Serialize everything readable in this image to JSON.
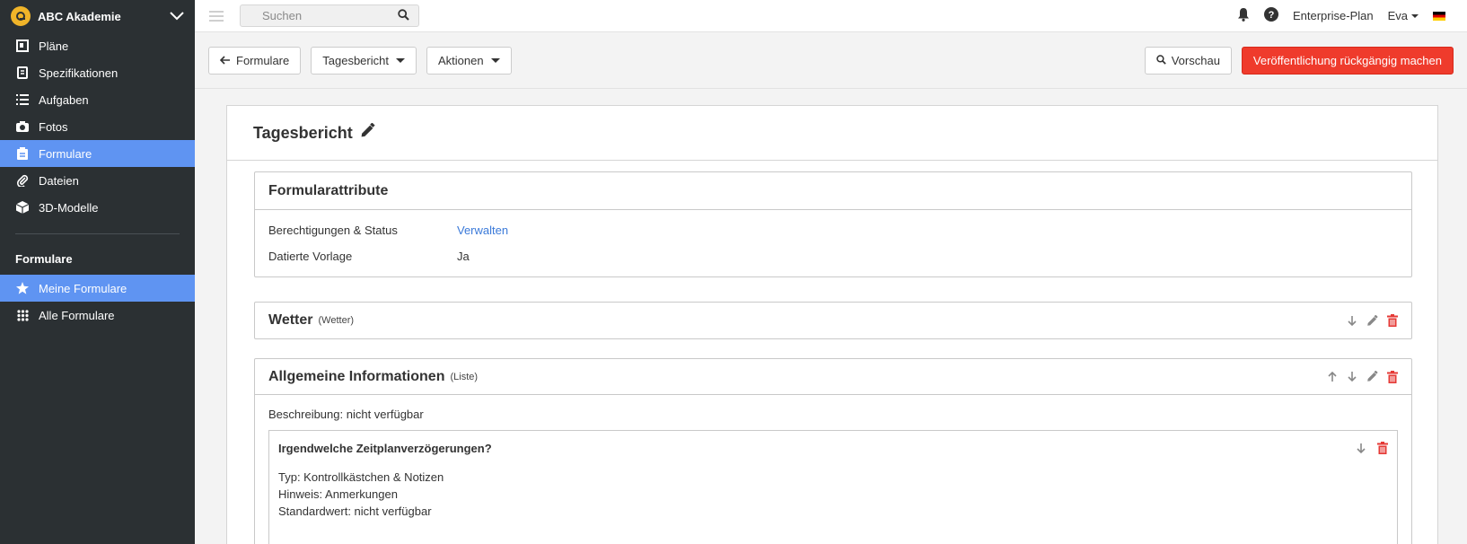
{
  "sidebar": {
    "org_name": "ABC Akademie",
    "items": [
      {
        "label": "Pläne",
        "icon": "plans-icon"
      },
      {
        "label": "Spezifikationen",
        "icon": "specs-icon"
      },
      {
        "label": "Aufgaben",
        "icon": "tasks-icon"
      },
      {
        "label": "Fotos",
        "icon": "camera-icon"
      },
      {
        "label": "Formulare",
        "icon": "clipboard-icon",
        "active": true
      },
      {
        "label": "Dateien",
        "icon": "paperclip-icon"
      },
      {
        "label": "3D-Modelle",
        "icon": "cube-icon"
      }
    ],
    "section_title": "Formulare",
    "section_items": [
      {
        "label": "Meine Formulare",
        "icon": "star-icon",
        "active": true
      },
      {
        "label": "Alle Formulare",
        "icon": "grid-icon"
      }
    ]
  },
  "topbar": {
    "search_placeholder": "Suchen",
    "plan": "Enterprise-Plan",
    "user": "Eva"
  },
  "toolbar": {
    "back_label": "Formulare",
    "form_dropdown": "Tagesbericht",
    "actions_dropdown": "Aktionen",
    "preview_label": "Vorschau",
    "unpublish_label": "Veröffentlichung rückgängig machen"
  },
  "form": {
    "title": "Tagesbericht",
    "attributes": {
      "title": "Formularattribute",
      "rows": [
        {
          "key": "Berechtigungen & Status",
          "value": "Verwalten"
        },
        {
          "key": "Datierte Vorlage",
          "value": "Ja"
        }
      ]
    },
    "sections": [
      {
        "title": "Wetter",
        "type": "(Wetter)"
      },
      {
        "title": "Allgemeine Informationen",
        "type": "(Liste)",
        "description": "Beschreibung: nicht verfügbar",
        "field": {
          "title": "Irgendwelche Zeitplanverzögerungen?",
          "lines": [
            "Typ: Kontrollkästchen & Notizen",
            "Hinweis: Anmerkungen",
            "Standardwert: nicht verfügbar"
          ]
        }
      }
    ]
  },
  "colors": {
    "sidebar_bg": "#2b3033",
    "active_blue": "#5f94f2",
    "danger": "#ef3b2c",
    "link": "#3b7ad9"
  }
}
